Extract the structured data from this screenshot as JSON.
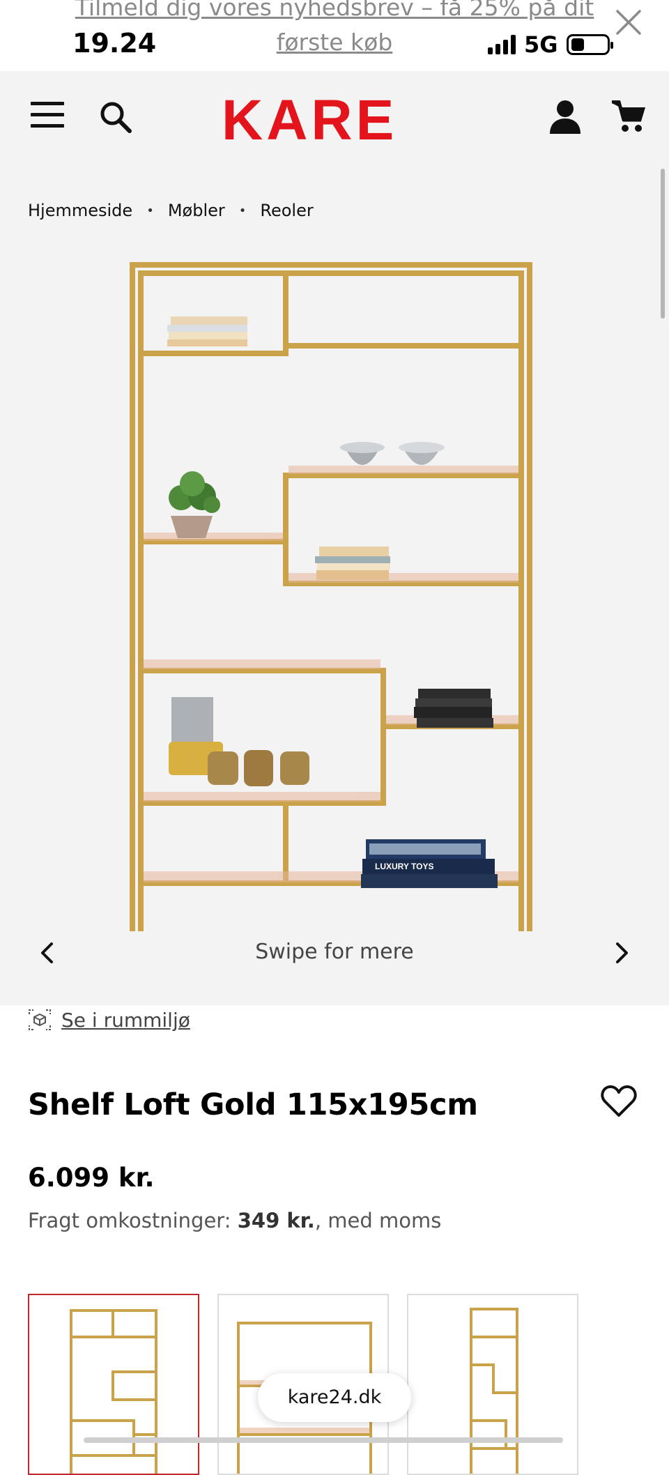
{
  "promo": {
    "line1": "Tilmeld dig vores nyhedsbrev – få 25% på dit",
    "line2": "første køb"
  },
  "status": {
    "time": "19.24",
    "network": "5G"
  },
  "header": {
    "logo": "KARE"
  },
  "breadcrumb": [
    "Hjemmeside",
    "Møbler",
    "Reoler"
  ],
  "carousel": {
    "hint": "Swipe for mere"
  },
  "room_view": {
    "label": "Se i rummiljø"
  },
  "product": {
    "title": "Shelf Loft Gold 115x195cm",
    "price": "6.099 kr.",
    "shipping_label": "Fragt omkostninger:",
    "shipping_price": "349 kr.",
    "shipping_suffix": ", med moms",
    "book_title": "LUXURY TOYS"
  },
  "colors": {
    "brand": "#e3141c",
    "gold": "#c9a24a",
    "active_thumb": "#c0272d"
  },
  "browser": {
    "url": "kare24.dk"
  }
}
